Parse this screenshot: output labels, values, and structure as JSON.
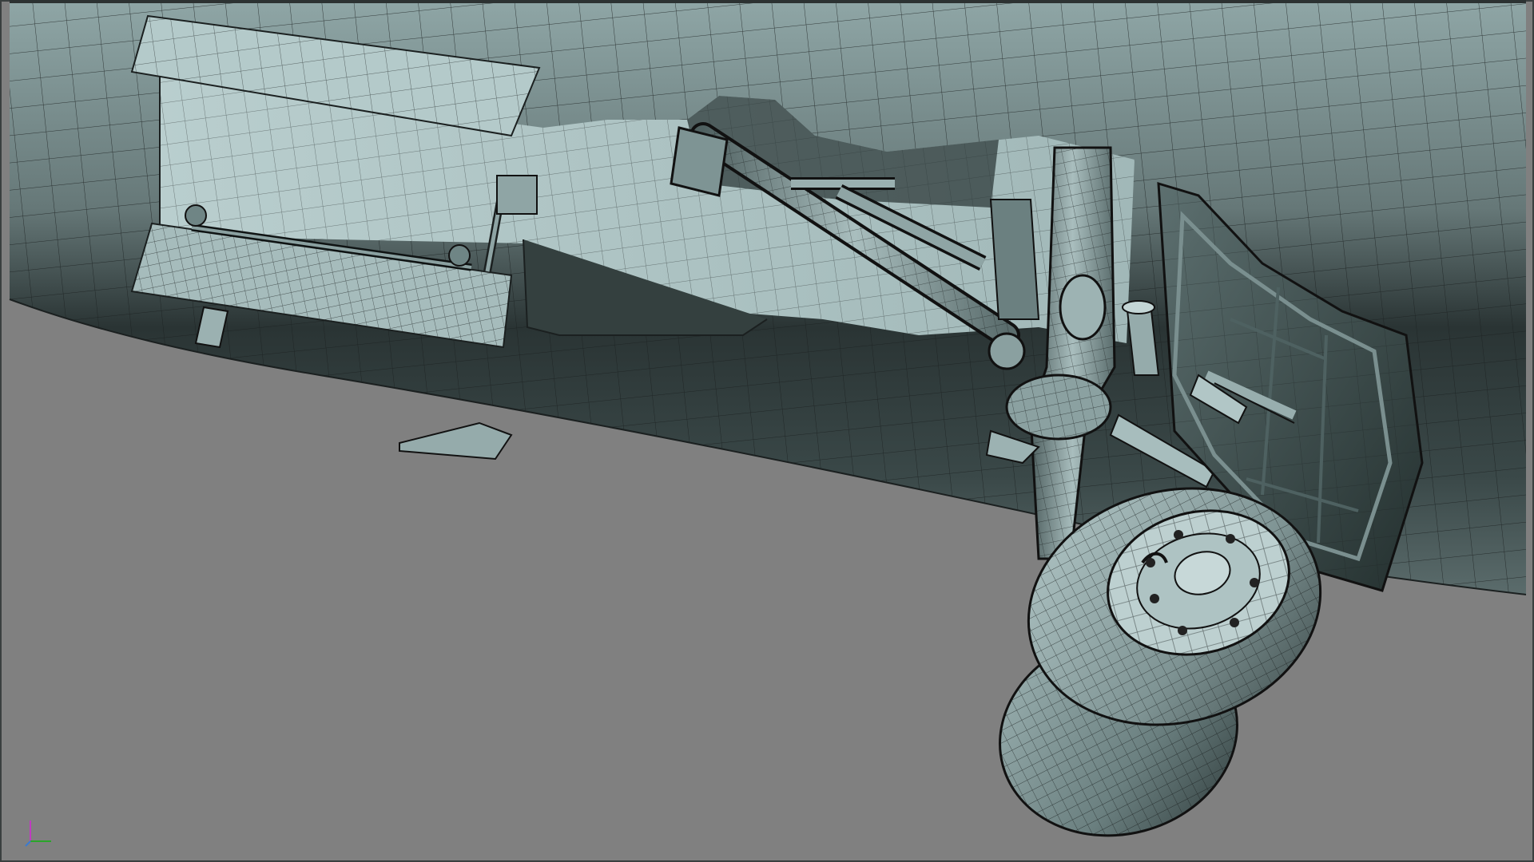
{
  "viewport": {
    "background_color": "#808080",
    "mesh_color": "#a9c0c0",
    "mesh_shadow_color": "#2b3434",
    "wire_color": "#1b2020",
    "display_mode": "wireframe-on-shaded"
  },
  "scene": {
    "subject": "landing-gear-bay-model"
  },
  "axis_gizmo": {
    "x_color": "#2aa52a",
    "y_color": "#c03ac0",
    "z_color": "#3a7ad0"
  }
}
